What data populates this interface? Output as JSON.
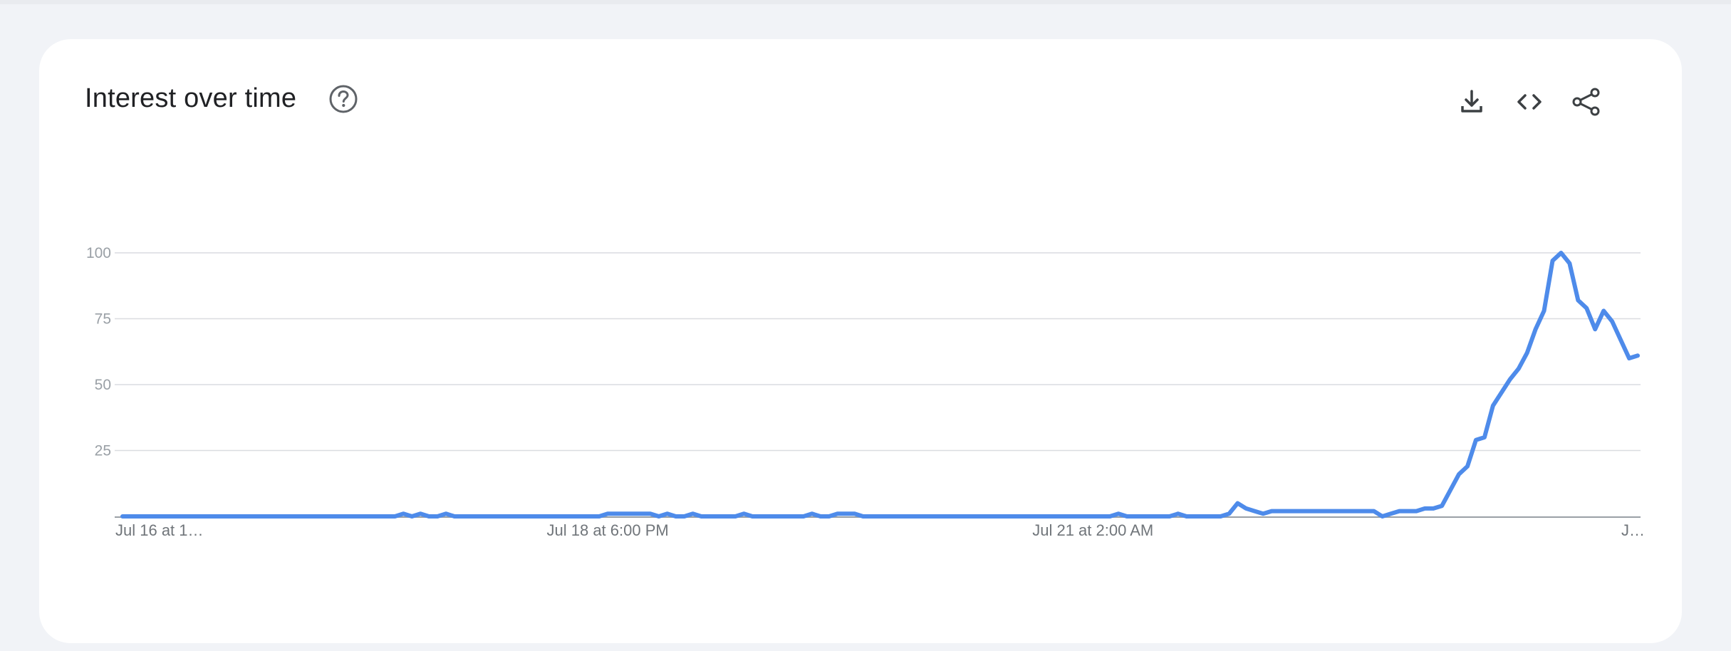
{
  "card": {
    "title": "Interest over time",
    "help_icon": "help-circle-icon"
  },
  "toolbar": {
    "download_icon": "download-icon",
    "embed_icon": "embed-code-icon",
    "share_icon": "share-icon"
  },
  "colors": {
    "line": "#4e8bea",
    "grid": "#dadce0",
    "axis": "#9aa0a6",
    "background": "#f1f3f7",
    "card": "#ffffff"
  },
  "chart_data": {
    "type": "line",
    "title": "Interest over time",
    "xlabel": "",
    "ylabel": "",
    "ylim": [
      0,
      100
    ],
    "y_ticks": [
      25,
      50,
      75,
      100
    ],
    "x_tick_labels": [
      "Jul 16 at 1…",
      "Jul 18 at 6:00 PM",
      "Jul 21 at 2:00 AM",
      "J…"
    ],
    "x_tick_index": [
      0,
      57,
      114,
      169
    ],
    "grid": true,
    "series": [
      {
        "values": [
          0,
          0,
          0,
          0,
          0,
          0,
          0,
          0,
          0,
          0,
          0,
          0,
          0,
          0,
          0,
          0,
          0,
          0,
          0,
          0,
          0,
          0,
          0,
          0,
          0,
          0,
          0,
          0,
          0,
          0,
          0,
          0,
          0,
          1,
          0,
          1,
          0,
          0,
          1,
          0,
          0,
          0,
          0,
          0,
          0,
          0,
          0,
          0,
          0,
          0,
          0,
          0,
          0,
          0,
          0,
          0,
          0,
          1,
          1,
          1,
          1,
          1,
          1,
          0,
          1,
          0,
          0,
          1,
          0,
          0,
          0,
          0,
          0,
          1,
          0,
          0,
          0,
          0,
          0,
          0,
          0,
          1,
          0,
          0,
          1,
          1,
          1,
          0,
          0,
          0,
          0,
          0,
          0,
          0,
          0,
          0,
          0,
          0,
          0,
          0,
          0,
          0,
          0,
          0,
          0,
          0,
          0,
          0,
          0,
          0,
          0,
          0,
          0,
          0,
          0,
          0,
          0,
          1,
          0,
          0,
          0,
          0,
          0,
          0,
          1,
          0,
          0,
          0,
          0,
          0,
          1,
          5,
          3,
          2,
          1,
          2,
          2,
          2,
          2,
          2,
          2,
          2,
          2,
          2,
          2,
          2,
          2,
          2,
          0,
          1,
          2,
          2,
          2,
          3,
          3,
          4,
          10,
          16,
          19,
          29,
          30,
          42,
          47,
          52,
          56,
          62,
          71,
          78,
          97,
          100,
          96,
          82,
          79,
          71,
          78,
          74,
          67,
          60,
          61
        ]
      }
    ]
  }
}
